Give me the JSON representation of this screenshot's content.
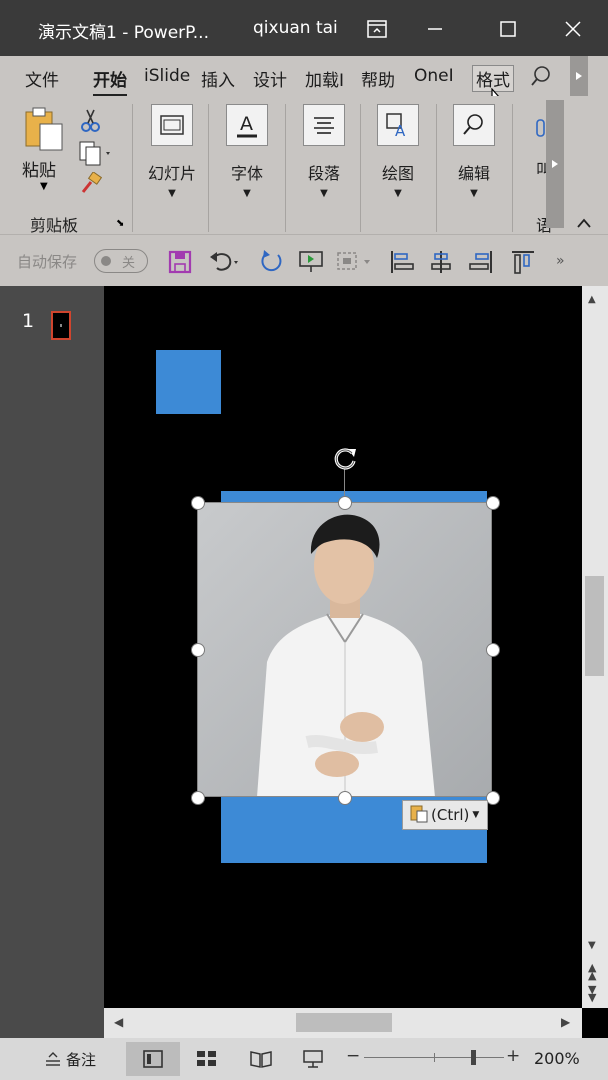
{
  "titlebar": {
    "title": "演示文稿1  -  PowerP...",
    "user": "qixuan tai"
  },
  "tabs": [
    "文件",
    "开始",
    "iSlide",
    "插入",
    "设计",
    "加载I",
    "帮助",
    "OneI",
    "格式"
  ],
  "active_tab": "开始",
  "ribbon": {
    "paste_label": "粘贴",
    "clipboard_group_label": "剪贴板",
    "groups": [
      "幻灯片",
      "字体",
      "段落",
      "绘图",
      "编辑"
    ],
    "partial_label_1": "叫",
    "partial_label_2": "语"
  },
  "qat": {
    "autosave_label": "自动保存",
    "autosave_state": "关"
  },
  "thumbnails": {
    "slide_number": "1"
  },
  "paste_options": {
    "label": "(Ctrl)"
  },
  "status": {
    "notes_label": "备注",
    "zoom": "200%",
    "zoom_fraction": 0.78
  },
  "colors": {
    "accent_blue": "#3d8ad6",
    "titlebar_bg": "#3a3a3a",
    "ribbon_bg": "#c8c5c2"
  }
}
